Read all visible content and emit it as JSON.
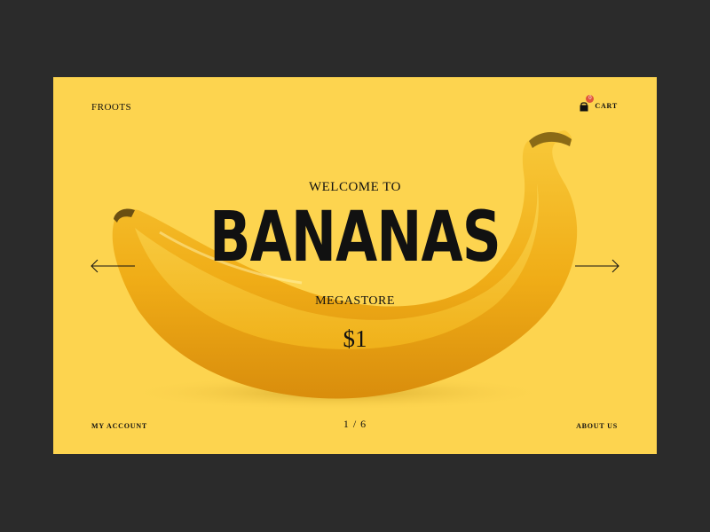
{
  "header": {
    "brand": "FROOTS",
    "cart_label": "CART",
    "cart_count": "0"
  },
  "hero": {
    "welcome": "WELCOME TO",
    "headline": "BANANAS",
    "subheadline": "MEGASTORE",
    "price": "$1"
  },
  "footer": {
    "my_account": "MY ACCOUNT",
    "pager": "1 / 6",
    "about_us": "ABOUT US"
  },
  "colors": {
    "page_background": "#2b2b2b",
    "hero_background": "#fdd44f",
    "banana": "#f2b51c",
    "cart_badge": "#e0553a",
    "text": "#111111"
  },
  "icons": {
    "cart": "shopping-bag-icon",
    "prev": "arrow-left-icon",
    "next": "arrow-right-icon"
  }
}
